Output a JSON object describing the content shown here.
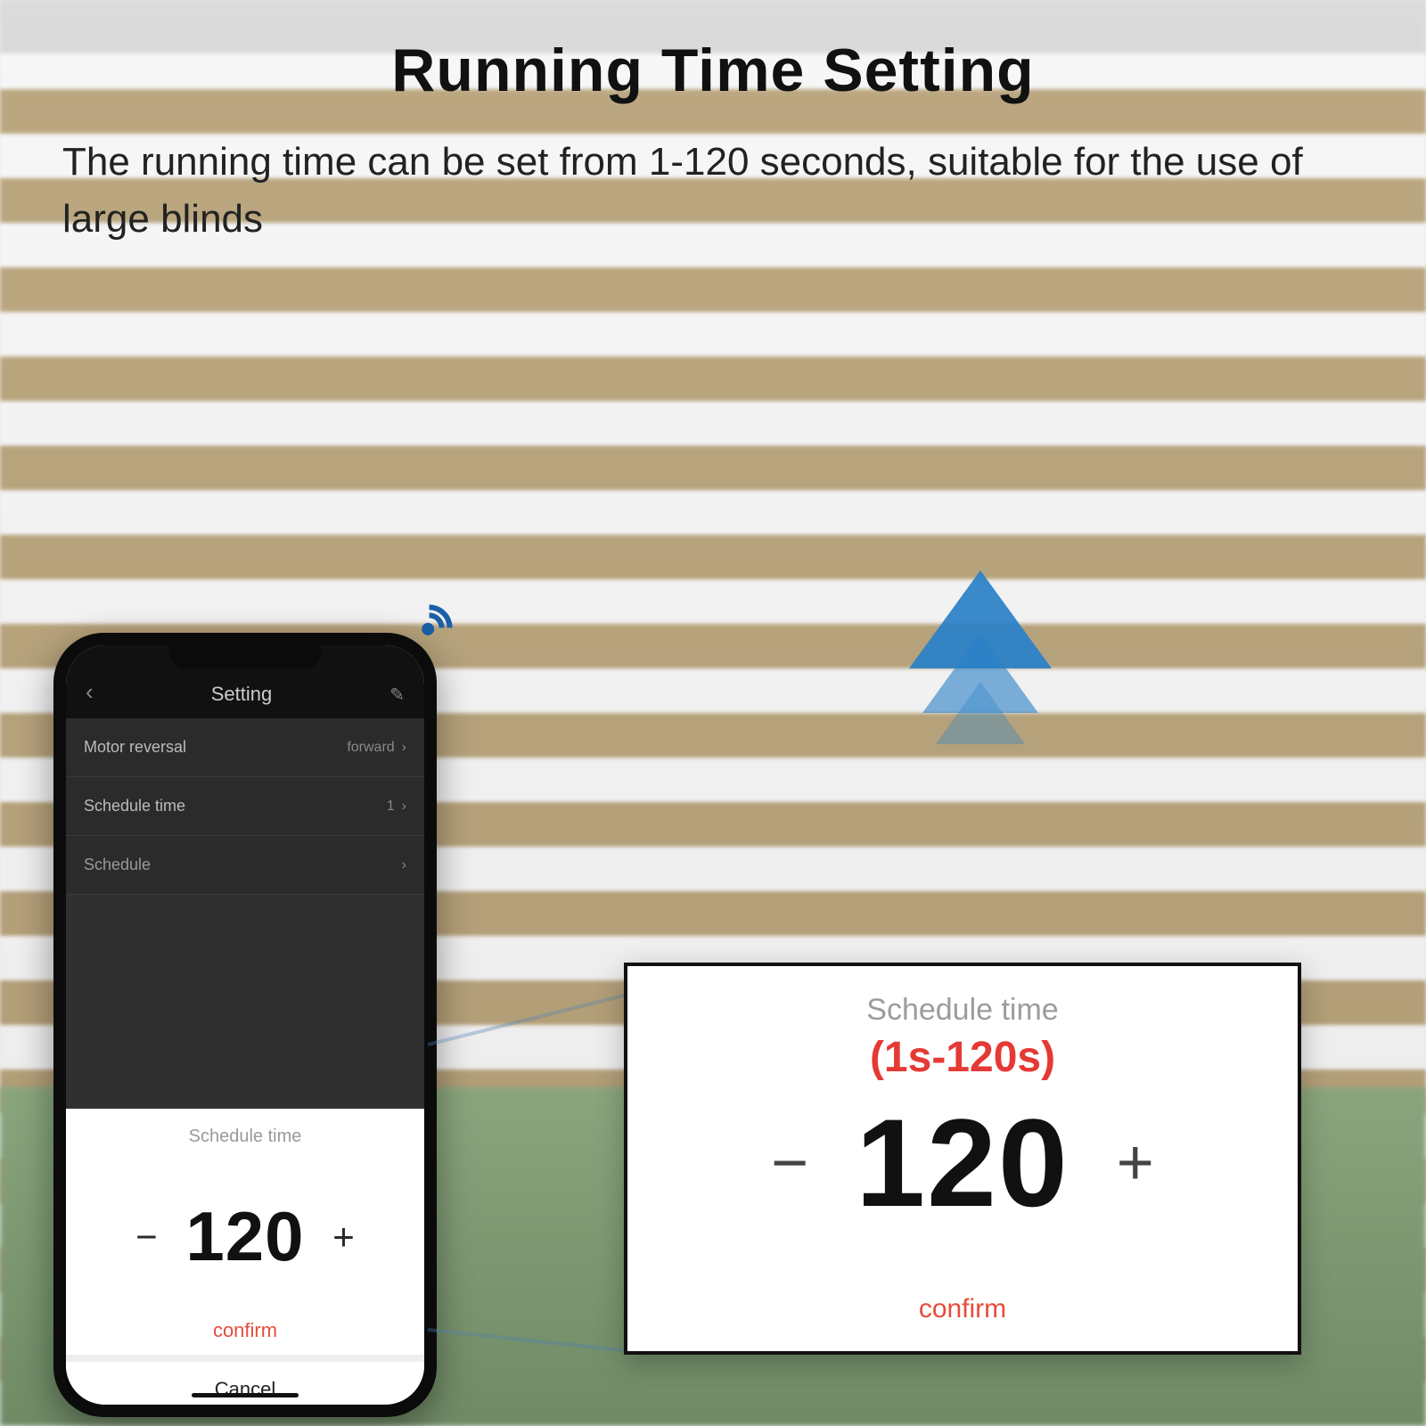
{
  "headline": "Running Time Setting",
  "subtext": "The running time can be set from 1-120 seconds, suitable for the use of large blinds",
  "phone": {
    "topbar_title": "Setting",
    "rows": {
      "motor_reversal": {
        "label": "Motor reversal",
        "value": "forward"
      },
      "schedule_time": {
        "label": "Schedule time",
        "value": "1"
      },
      "schedule": {
        "label": "Schedule",
        "value": ""
      }
    },
    "sheet": {
      "title": "Schedule time",
      "value": "120",
      "confirm": "confirm",
      "cancel": "Cancel"
    }
  },
  "zoom": {
    "title": "Schedule time",
    "range": "(1s-120s)",
    "value": "120",
    "confirm": "confirm"
  }
}
